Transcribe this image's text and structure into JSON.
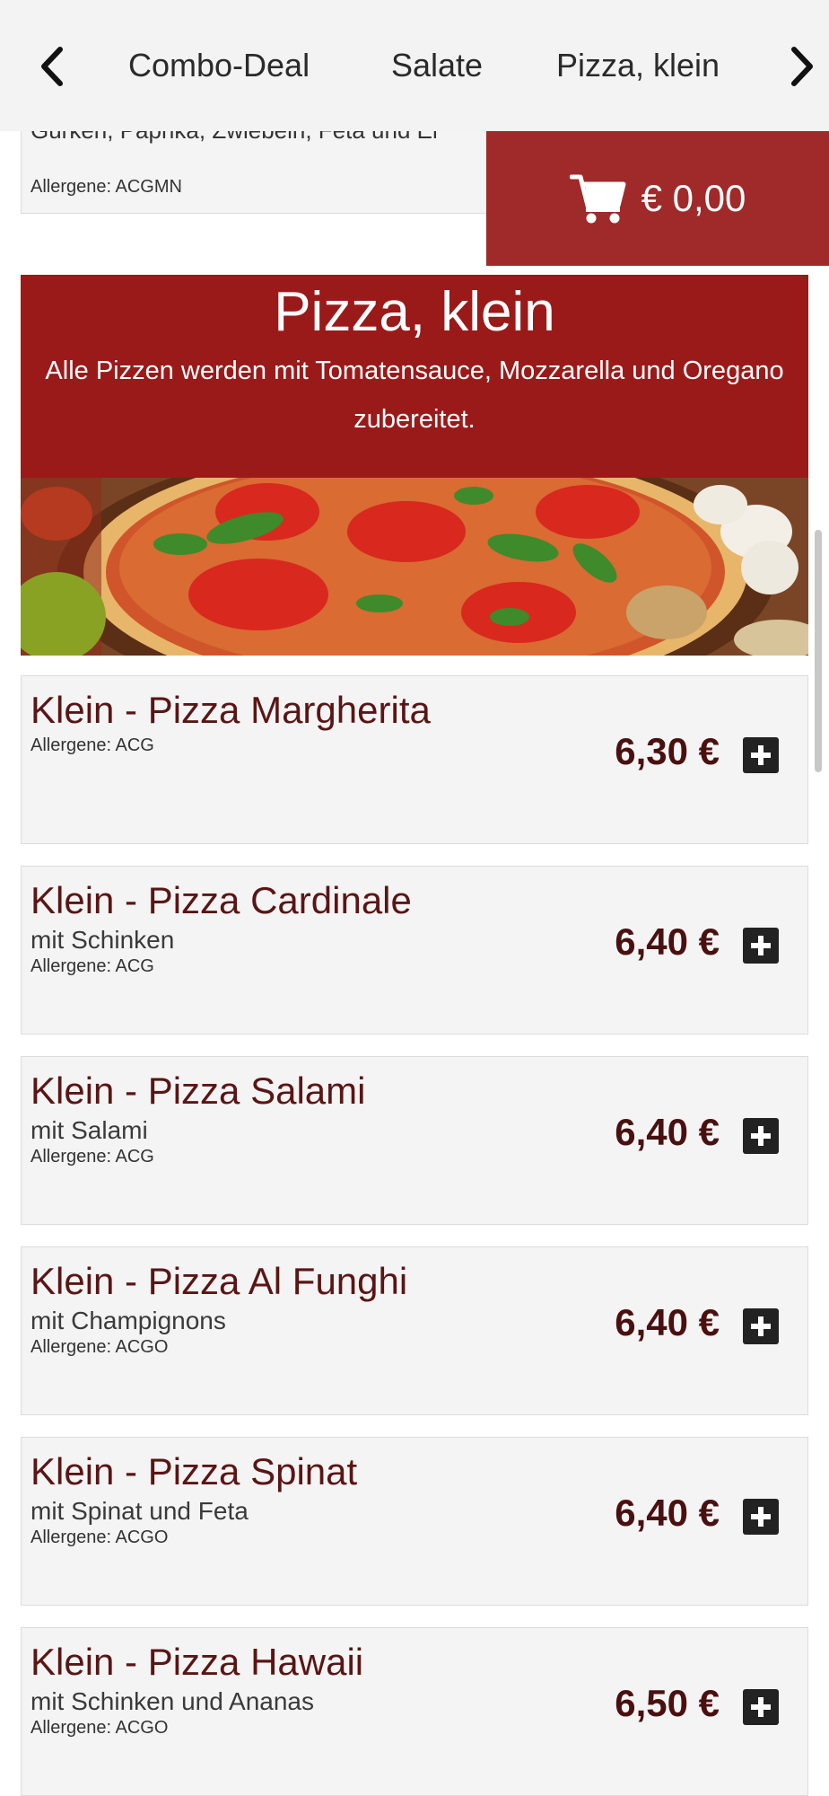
{
  "nav": {
    "prev_icon": "chevron-left-icon",
    "next_icon": "chevron-right-icon",
    "tabs": [
      {
        "label": "Combo-Deal"
      },
      {
        "label": "Salate"
      },
      {
        "label": "Pizza, klein"
      }
    ]
  },
  "previous_item": {
    "description": "Gurken, Paprika, Zwiebeln, Feta und Ei",
    "allergens": "Allergene: ACGMN"
  },
  "cart": {
    "icon": "shopping-cart-icon",
    "total": "€ 0,00"
  },
  "section": {
    "title": "Pizza, klein",
    "description": "Alle Pizzen werden mit Tomatensauce, Mozzarella und Oregano zubereitet."
  },
  "items": [
    {
      "name": "Klein - Pizza Margherita",
      "description": "",
      "allergens": "Allergene: ACG",
      "price": "6,30 €"
    },
    {
      "name": "Klein - Pizza Cardinale",
      "description": "mit Schinken",
      "allergens": "Allergene: ACG",
      "price": "6,40 €"
    },
    {
      "name": "Klein - Pizza Salami",
      "description": "mit Salami",
      "allergens": "Allergene: ACG",
      "price": "6,40 €"
    },
    {
      "name": "Klein - Pizza Al Funghi",
      "description": "mit Champignons",
      "allergens": "Allergene: ACGO",
      "price": "6,40 €"
    },
    {
      "name": "Klein - Pizza Spinat",
      "description": "mit Spinat und Feta",
      "allergens": "Allergene: ACGO",
      "price": "6,40 €"
    },
    {
      "name": "Klein - Pizza Hawaii",
      "description": "mit Schinken und Ananas",
      "allergens": "Allergene: ACGO",
      "price": "6,50 €"
    }
  ],
  "colors": {
    "brand_red": "#9a1a1a",
    "cart_red": "#a02a2a",
    "item_title": "#5a1515",
    "price": "#4a1010"
  }
}
